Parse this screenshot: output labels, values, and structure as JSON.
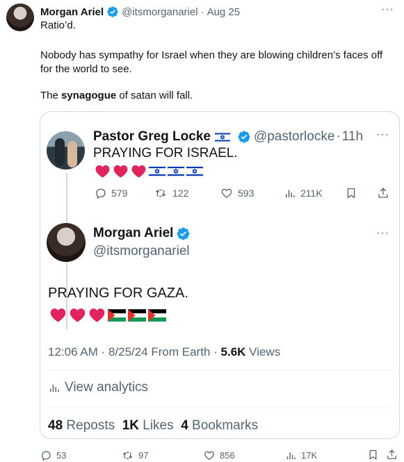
{
  "tweet": {
    "author_name": "Morgan Ariel",
    "handle": "@itsmorganariel",
    "separator": "·",
    "date": "Aug 25",
    "more": "···",
    "line1": "Ratio’d.",
    "line2": "Nobody has sympathy for Israel when they are blowing children’s faces off for the world to see.",
    "line3_prefix": "The ",
    "line3_bold": "synagogue",
    "line3_suffix": " of satan will fall.",
    "actions": {
      "replies": "53",
      "reposts": "97",
      "likes": "856",
      "views": "17K"
    }
  },
  "quote": {
    "parent": {
      "author_name": "Pastor Greg Locke",
      "handle": "@pastorlocke",
      "separator": "·",
      "time": "11h",
      "more": "···",
      "text": "PRAYING FOR ISRAEL.",
      "emojis": [
        "red-heart",
        "red-heart",
        "red-heart",
        "israel-flag",
        "israel-flag",
        "israel-flag"
      ],
      "actions": {
        "replies": "579",
        "reposts": "122",
        "likes": "593",
        "views": "211K"
      }
    },
    "reply": {
      "author_name": "Morgan Ariel",
      "handle": "@itsmorganariel",
      "more": "···",
      "text": "PRAYING FOR GAZA.",
      "emojis": [
        "red-heart",
        "red-heart",
        "red-heart",
        "palestine-flag",
        "palestine-flag",
        "palestine-flag"
      ],
      "timestamp": "12:06 AM · 8/25/24 From Earth · ",
      "views_count": "5.6K",
      "views_label": " Views",
      "analytics_label": "View analytics",
      "reposts_count": "48",
      "reposts_label": " Reposts",
      "likes_count": "1K",
      "likes_label": " Likes",
      "bookmarks_count": "4",
      "bookmarks_label": " Bookmarks"
    }
  },
  "colors": {
    "verified": "#1d9bf0",
    "text": "#0f1419",
    "muted": "#536471",
    "border": "#cfd9de",
    "heart": "#e0245e"
  }
}
